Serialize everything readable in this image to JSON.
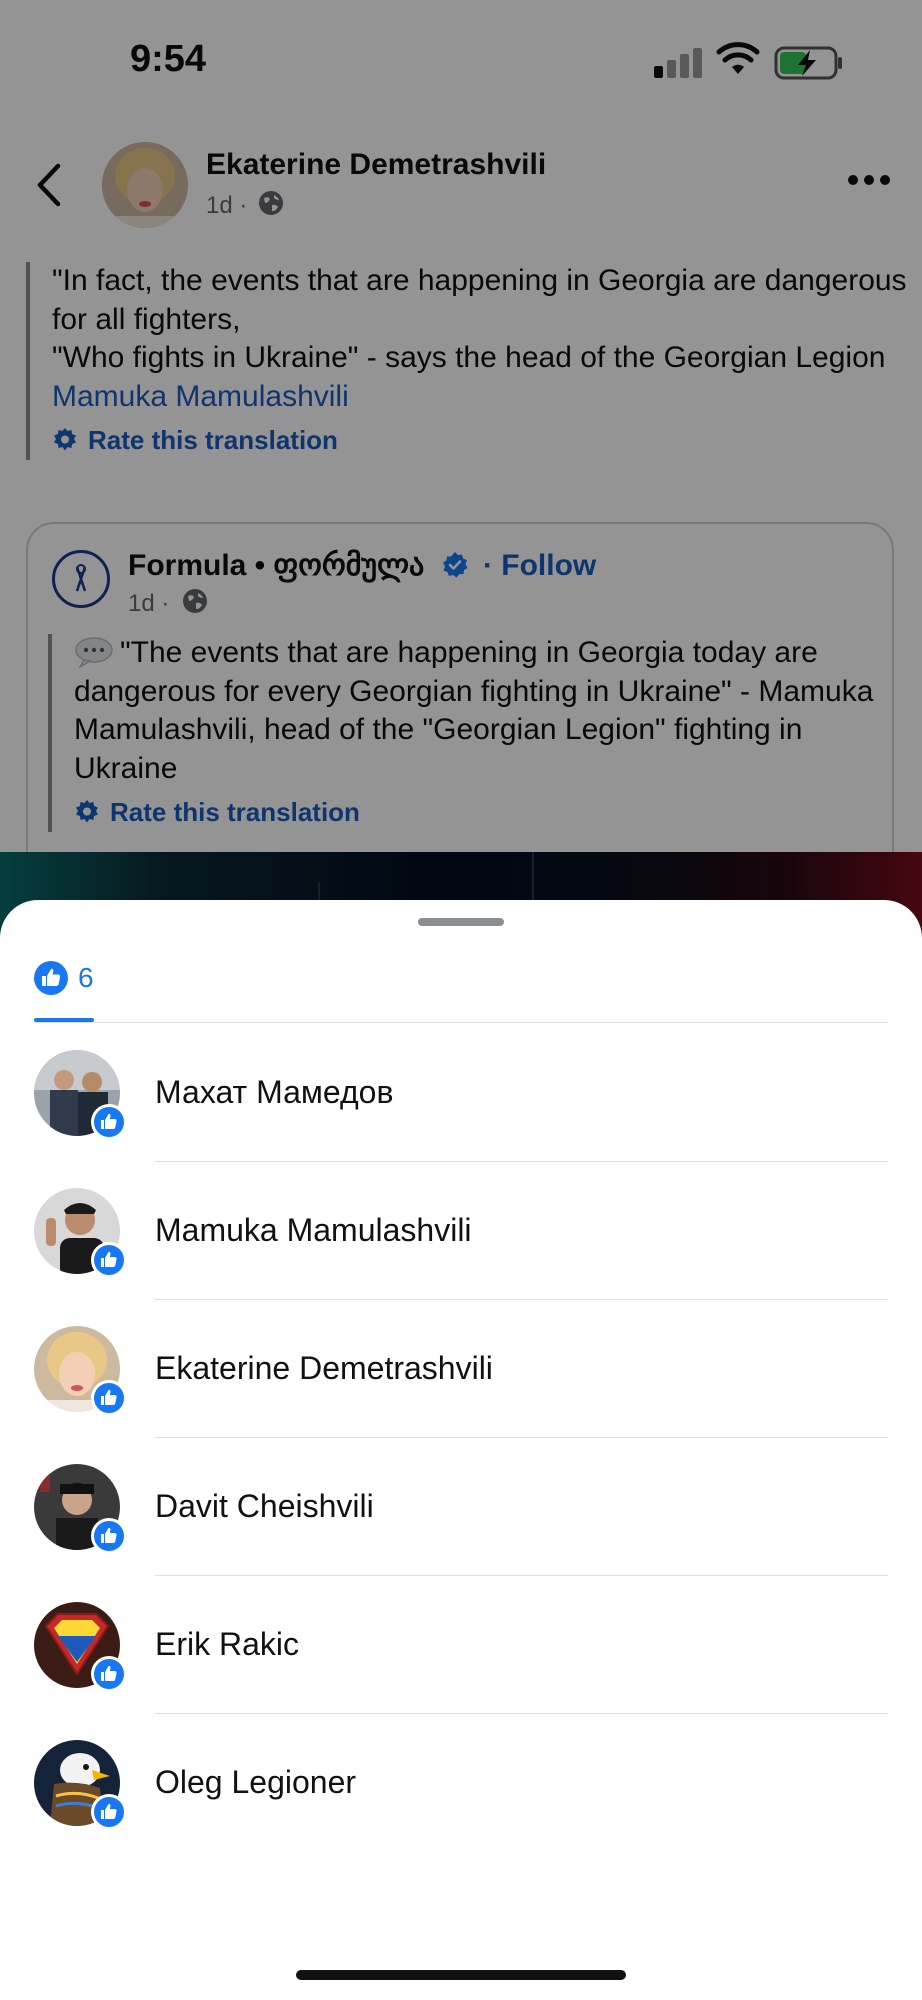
{
  "status_bar": {
    "time": "9:54"
  },
  "post": {
    "author": "Ekaterine Demetrashvili",
    "time": "1d",
    "separator": "·",
    "text_lines": [
      "\"In fact, the events that are happening in Georgia are dangerous for all fighters,",
      "\"Who fights in Ukraine\" - says the head of the Georgian Legion"
    ],
    "mention": "Mamuka Mamulashvili",
    "rate_translation": "Rate this translation"
  },
  "shared": {
    "page_name": "Formula • ფორმულა",
    "follow_prefix": "·",
    "follow": "Follow",
    "time": "1d",
    "separator": "·",
    "text": "\"The events that are happening in Georgia today are dangerous for every Georgian fighting in Ukraine\" - Mamuka Mamulashvili, head of the \"Georgian Legion\" fighting in Ukraine",
    "rate_translation": "Rate this translation"
  },
  "reactions_sheet": {
    "tab_count": "6",
    "people": [
      {
        "name": "Махат Мамедов"
      },
      {
        "name": "Mamuka Mamulashvili"
      },
      {
        "name": "Ekaterine Demetrashvili"
      },
      {
        "name": "Davit Cheishvili"
      },
      {
        "name": "Erik Rakic"
      },
      {
        "name": "Oleg Legioner"
      }
    ]
  },
  "colors": {
    "accent": "#1877f2",
    "link": "#1a5cc0"
  }
}
